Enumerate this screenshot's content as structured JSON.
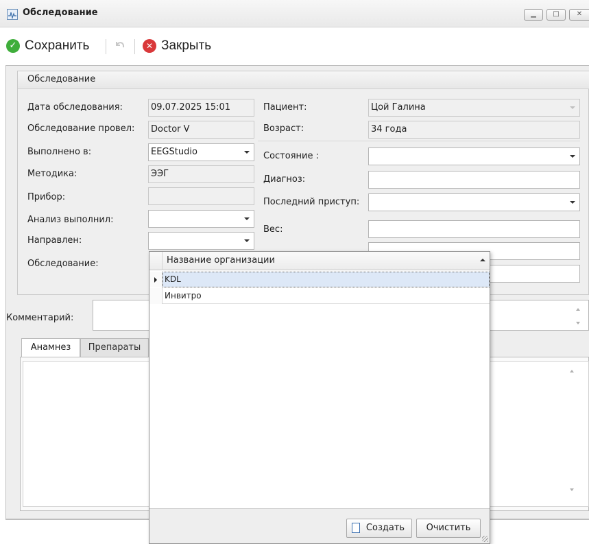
{
  "window": {
    "title": "Обследование",
    "icon": "chart-window-icon",
    "controls": [
      "minimize",
      "maximize",
      "close"
    ]
  },
  "toolbar": {
    "save_label": "Сохранить",
    "undo_icon": "undo-icon",
    "close_label": "Закрыть"
  },
  "group": {
    "title": "Обследование"
  },
  "left_fields": {
    "date_label": "Дата обследования:",
    "date_value": "09.07.2025 15:01",
    "performed_by_label": "Обследование провел:",
    "performed_by_value": "Doctor V",
    "done_in_label": "Выполнено в:",
    "done_in_value": "EEGStudio",
    "method_label": "Методика:",
    "method_value": "ЭЭГ",
    "device_label": "Прибор:",
    "device_value": "",
    "analysis_label": "Анализ выполнил:",
    "analysis_value": "",
    "referred_label": "Направлен:",
    "referred_value": "",
    "exam_label": "Обследование:"
  },
  "right_fields": {
    "patient_label": "Пациент:",
    "patient_value": "Цой Галина",
    "age_label": "Возраст:",
    "age_value": "34 года",
    "condition_label": "Состояние :",
    "condition_value": "",
    "diagnosis_label": "Диагноз:",
    "diagnosis_value": "",
    "last_attack_label": "Последний приступ:",
    "last_attack_value": "",
    "weight_label": "Вес:",
    "weight_value": ""
  },
  "comment": {
    "label": "Комментарий:",
    "value": ""
  },
  "tabs": [
    {
      "label": "Анамнез",
      "active": true
    },
    {
      "label": "Препараты",
      "active": false
    }
  ],
  "popup": {
    "column_header": "Название организации",
    "rows": [
      "KDL",
      "Инвитро"
    ],
    "selected_row": "KDL",
    "create_label": "Создать",
    "clear_label": "Очистить"
  },
  "colors": {
    "save_icon": "#3fae3b",
    "close_icon": "#d9383a",
    "selection": "#dde8f7"
  }
}
